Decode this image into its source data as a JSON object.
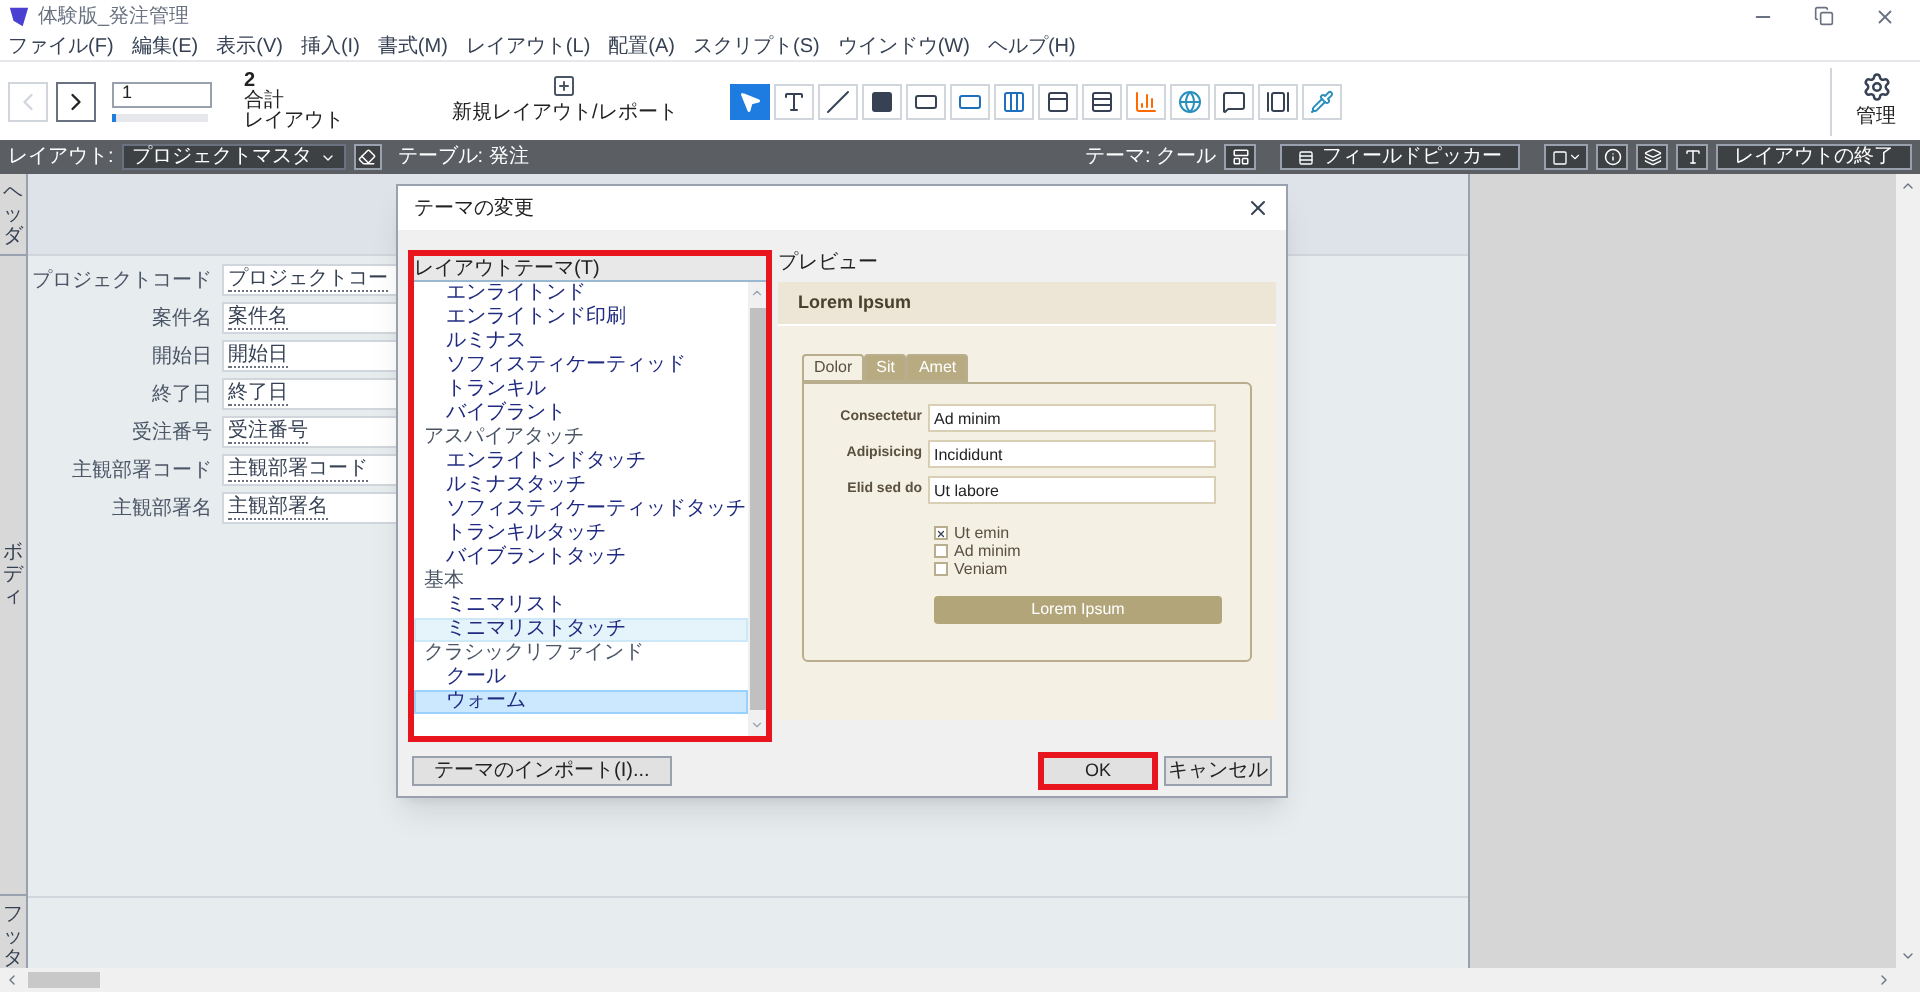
{
  "window": {
    "title": "体験版_発注管理"
  },
  "menu": [
    "ファイル(F)",
    "編集(E)",
    "表示(V)",
    "挿入(I)",
    "書式(M)",
    "レイアウト(L)",
    "配置(A)",
    "スクリプト(S)",
    "ウインドウ(W)",
    "ヘルプ(H)"
  ],
  "toolbar": {
    "record": {
      "value": "1",
      "level": 0.05
    },
    "total": "2",
    "total_label": "合計",
    "unit_label": "レイアウト",
    "new_layout": "新規レイアウト/レポート",
    "manage": "管理",
    "tools": [
      {
        "kind": "pointer",
        "selected": true
      },
      {
        "kind": "text",
        "selected": false
      },
      {
        "kind": "line",
        "selected": false
      },
      {
        "kind": "shape",
        "selected": false
      },
      {
        "kind": "field",
        "selected": false
      },
      {
        "kind": "button",
        "selected": false
      },
      {
        "kind": "buttonbar",
        "selected": false
      },
      {
        "kind": "tab",
        "selected": false
      },
      {
        "kind": "portal",
        "selected": false
      },
      {
        "kind": "chart",
        "selected": false
      },
      {
        "kind": "web",
        "selected": false
      },
      {
        "kind": "popover",
        "selected": false
      },
      {
        "kind": "slide",
        "selected": false
      },
      {
        "kind": "picker",
        "selected": false
      }
    ]
  },
  "layout_bar": {
    "layout_label": "レイアウト:",
    "layout": "プロジェクトマスタ",
    "table": "テーブル: 発注",
    "theme": "テーマ: クール",
    "field_picker": "フィールドピッカー",
    "exit": "レイアウトの終了"
  },
  "parts": [
    {
      "label": "ヘッダ"
    },
    {
      "label": "ボディ"
    },
    {
      "label": "フッタ"
    }
  ],
  "form_fields": [
    {
      "label": "プロジェクトコード",
      "value": "プロジェクトコー"
    },
    {
      "label": "案件名",
      "value": "案件名"
    },
    {
      "label": "開始日",
      "value": "開始日"
    },
    {
      "label": "終了日",
      "value": "終了日"
    },
    {
      "label": "受注番号",
      "value": "受注番号"
    },
    {
      "label": "主観部署コード",
      "value": "主観部署コード"
    },
    {
      "label": "主観部署名",
      "value": "主観部署名"
    }
  ],
  "dialog": {
    "title": "テーマの変更",
    "list_label": "レイアウトテーマ(T)",
    "preview_label": "プレビュー",
    "themes": [
      {
        "children": [
          {
            "label": "エンライトンド",
            "selected": false,
            "hovered": false
          },
          {
            "label": "エンライトンド印刷",
            "selected": false,
            "hovered": false
          },
          {
            "label": "ルミナス",
            "selected": false,
            "hovered": false
          },
          {
            "label": "ソフィスティケーティッド",
            "selected": false,
            "hovered": false
          },
          {
            "label": "トランキル",
            "selected": false,
            "hovered": false
          },
          {
            "label": "バイブラント",
            "selected": false,
            "hovered": false
          }
        ]
      },
      {
        "label": "アスパイアタッチ",
        "children": [
          {
            "label": "エンライトンドタッチ",
            "selected": false,
            "hovered": false
          },
          {
            "label": "ルミナスタッチ",
            "selected": false,
            "hovered": false
          },
          {
            "label": "ソフィスティケーティッドタッチ",
            "selected": false,
            "hovered": false
          },
          {
            "label": "トランキルタッチ",
            "selected": false,
            "hovered": false
          },
          {
            "label": "バイブラントタッチ",
            "selected": false,
            "hovered": false
          }
        ]
      },
      {
        "label": "基本",
        "children": [
          {
            "label": "ミニマリスト",
            "selected": false,
            "hovered": false
          },
          {
            "label": "ミニマリストタッチ",
            "selected": false,
            "hovered": true
          }
        ]
      },
      {
        "label": "クラシックリファインド",
        "children": [
          {
            "label": "クール",
            "selected": false,
            "hovered": false
          },
          {
            "label": "ウォーム",
            "selected": true,
            "hovered": false
          }
        ]
      }
    ],
    "preview": {
      "title": "Lorem Ipsum",
      "tabs": [
        {
          "label": "Dolor",
          "selected": true
        },
        {
          "label": "Sit",
          "selected": false
        },
        {
          "label": "Amet",
          "selected": false
        }
      ],
      "fields": [
        {
          "label": "Consectetur",
          "value": "Ad minim"
        },
        {
          "label": "Adipisicing",
          "value": "Incididunt"
        },
        {
          "label": "Elid sed do",
          "value": "Ut labore"
        }
      ],
      "checkboxes": [
        {
          "label": "Ut emin",
          "checked": true
        },
        {
          "label": "Ad minim",
          "checked": false
        },
        {
          "label": "Veniam",
          "checked": false
        }
      ],
      "button": "Lorem Ipsum"
    },
    "import_button": "テーマのインポート(I)...",
    "ok": "OK",
    "cancel": "キャンセル"
  }
}
